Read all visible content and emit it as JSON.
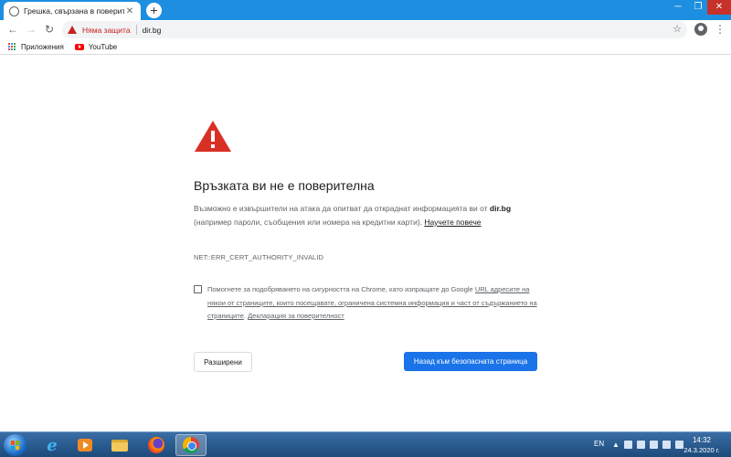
{
  "browser": {
    "tab": {
      "title": "Грешка, свързана в поверителн",
      "favicon": "globe-icon",
      "close_icon": "close-icon"
    },
    "new_tab_icon": "plus-icon",
    "window_controls": {
      "minimize": "minimize-icon",
      "maximize": "maximize-icon",
      "close": "close-icon"
    },
    "toolbar": {
      "back_icon": "back-arrow-icon",
      "forward_icon": "forward-arrow-icon",
      "reload_icon": "reload-icon",
      "security_label": "Няма защита",
      "url": "dir.bg",
      "star_icon": "star-icon",
      "profile_icon": "account-icon",
      "menu_icon": "more-vert-icon"
    },
    "bookmarks": [
      {
        "label": "Приложения",
        "icon": "apps-grid-icon"
      },
      {
        "label": "YouTube",
        "icon": "youtube-icon"
      }
    ]
  },
  "interstitial": {
    "icon": "warning-triangle-icon",
    "heading": "Връзката ви не е поверителна",
    "description_prefix": "Възможно е извършители на атака да опитват да откраднат информацията ви от",
    "domain": "dir.bg",
    "description_suffix": "(например пароли, съобщения или номера на кредитни карти).",
    "learn_more": "Научете повече",
    "error_code": "NET::ERR_CERT_AUTHORITY_INVALID",
    "optin_text_1": "Помогнете за подобряването на сигурността на Chrome, като изпращате до Google",
    "optin_link_1": "URL адресите на някои от страниците, които посещавате, ограничена системна информация и част от съдържанието на страниците",
    "optin_sep": ".",
    "optin_link_2": "Декларация за поверителност",
    "optin_checked": false,
    "details_button": "Разширени",
    "back_button": "Назад към безопасната страница",
    "colors": {
      "warning": "#d93025",
      "primary_button": "#1a73e8"
    }
  },
  "taskbar": {
    "apps": [
      "internet-explorer-icon",
      "media-player-icon",
      "folder-icon",
      "firefox-icon",
      "chrome-icon"
    ],
    "active_app": "chrome-icon",
    "language": "EN",
    "time": "14:32",
    "date": "24.3.2020 г."
  }
}
